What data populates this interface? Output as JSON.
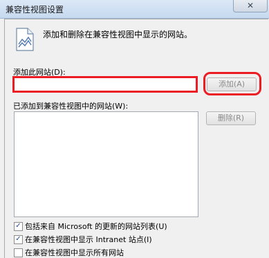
{
  "window": {
    "title": "兼容性视图设置",
    "close_glyph": "✕"
  },
  "description": "添加和删除在兼容性视图中显示的网站。",
  "add_site": {
    "label": "添加此网站(D):",
    "value": "",
    "button_label": "添加(A)"
  },
  "site_list": {
    "label": "已添加到兼容性视图中的网站(W):",
    "items": [],
    "remove_label": "删除(R)"
  },
  "options": [
    {
      "label": "包括来自 Microsoft 的更新的网站列表(U)",
      "checked": true
    },
    {
      "label": "在兼容性视图中显示 Intranet 站点(I)",
      "checked": true
    },
    {
      "label": "在兼容性视图中显示所有网站",
      "checked": false
    }
  ],
  "icons": [
    "document-icon",
    "close-icon"
  ],
  "colors": {
    "highlight": "#ec1c24",
    "titlebar": "#c6d9ef"
  }
}
